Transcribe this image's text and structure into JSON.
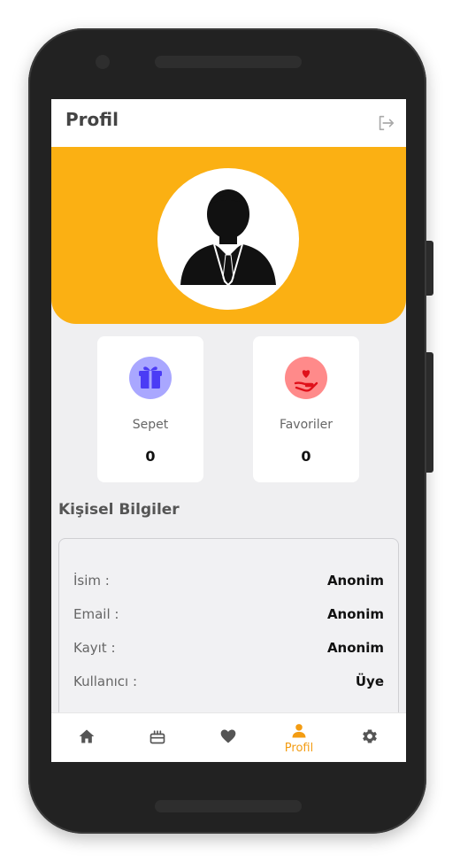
{
  "app": {
    "title": "Profil",
    "accent_color": "#fbb013"
  },
  "header": {
    "logout_icon": "logout-icon"
  },
  "stats": [
    {
      "label": "Sepet",
      "count": "0",
      "icon": "gift-icon",
      "badge_color": "#a9a7ff"
    },
    {
      "label": "Favoriler",
      "count": "0",
      "icon": "heart-hand-icon",
      "badge_color": "#ff8a8a"
    }
  ],
  "personal": {
    "title": "Kişisel Bilgiler",
    "rows": [
      {
        "key": "İsim :",
        "value": "Anonim"
      },
      {
        "key": "Email :",
        "value": "Anonim"
      },
      {
        "key": "Kayıt :",
        "value": "Anonim"
      },
      {
        "key": "Kullanıcı :",
        "value": "Üye"
      }
    ]
  },
  "nav": {
    "items": [
      {
        "icon": "home-icon"
      },
      {
        "icon": "cake-icon"
      },
      {
        "icon": "heart-icon"
      },
      {
        "icon": "person-icon",
        "label": "Profil",
        "active": true
      },
      {
        "icon": "gear-icon"
      }
    ]
  }
}
